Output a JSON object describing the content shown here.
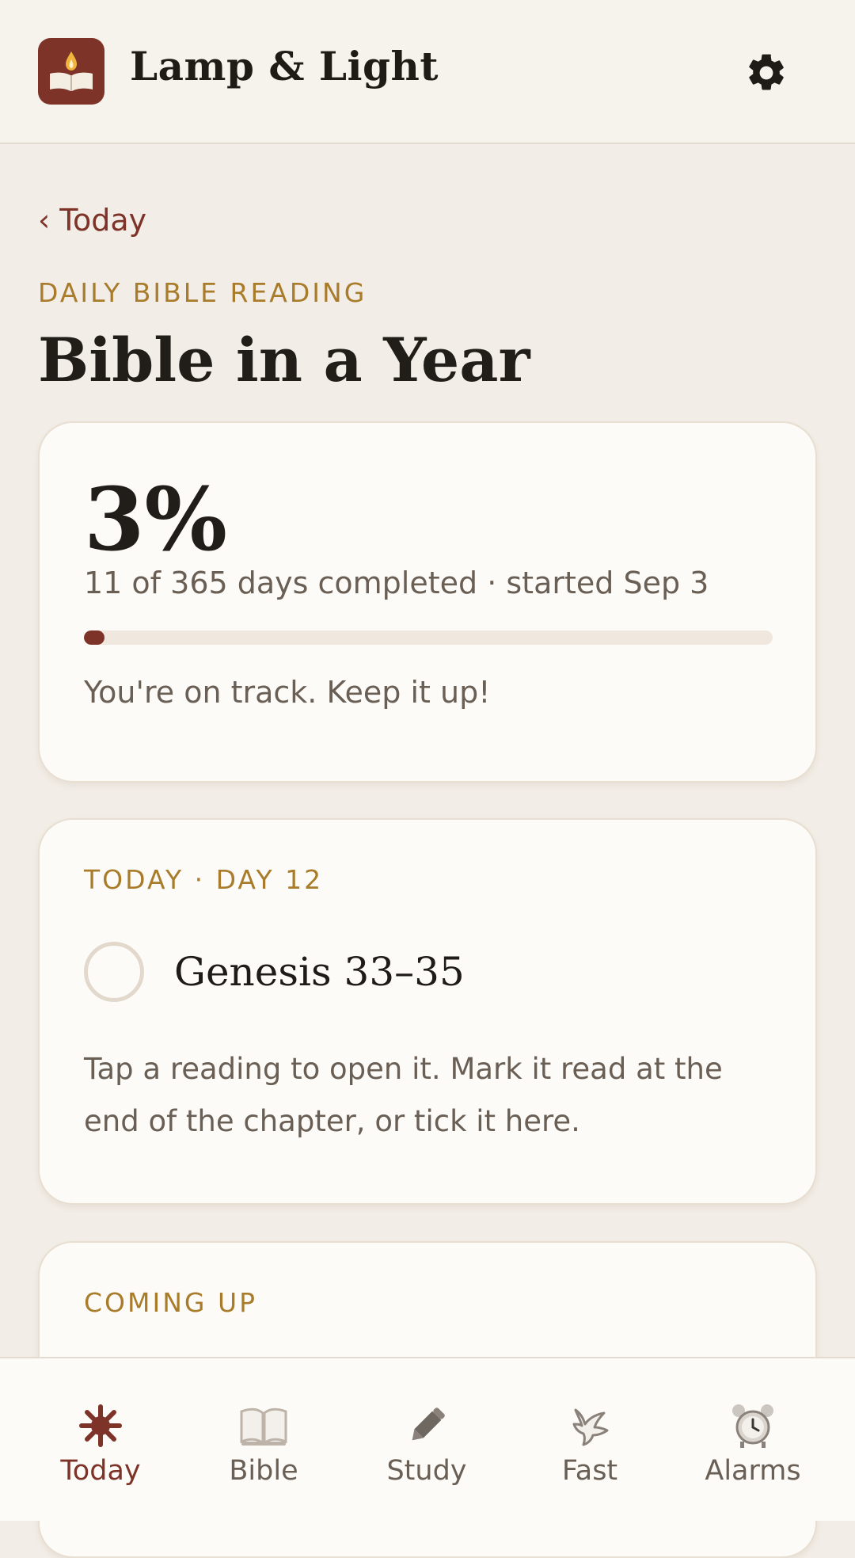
{
  "app": {
    "title": "Lamp & Light"
  },
  "nav_back": {
    "label": "‹ Today"
  },
  "section": {
    "eyebrow": "DAILY BIBLE READING",
    "title": "Bible in a Year"
  },
  "progress": {
    "percent_label": "3%",
    "completion_text": "11 of 365 days completed · started Sep 3",
    "status": "You're on track. Keep it up!",
    "fraction": 0.03
  },
  "today_card": {
    "eyebrow": "TODAY · DAY 12",
    "reading": "Genesis 33–35",
    "help": "Tap a reading to open it. Mark it read at the end of the chapter, or tick it here."
  },
  "coming_up": {
    "eyebrow": "COMING UP"
  },
  "bottom_nav": {
    "items": [
      {
        "label": "Today",
        "icon": "sun-icon",
        "active": true
      },
      {
        "label": "Bible",
        "icon": "open-book-icon",
        "active": false
      },
      {
        "label": "Study",
        "icon": "pencil-icon",
        "active": false
      },
      {
        "label": "Fast",
        "icon": "dove-icon",
        "active": false
      },
      {
        "label": "Alarms",
        "icon": "alarm-clock-icon",
        "active": false
      }
    ]
  },
  "colors": {
    "accent": "#7d3328",
    "gold": "#a87c2a",
    "background": "#f2ede6",
    "card": "#fdfbf8"
  }
}
